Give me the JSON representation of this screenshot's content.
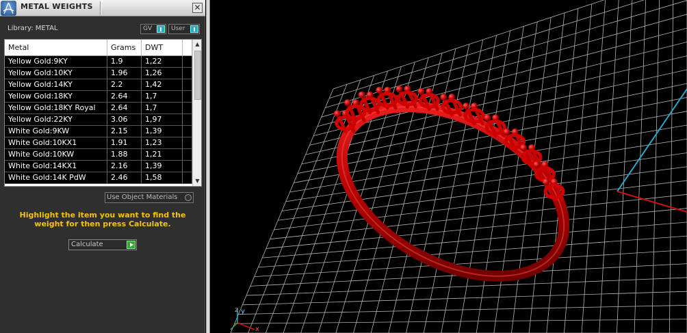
{
  "panel": {
    "title": "METAL WEIGHTS",
    "close_glyph": "✕",
    "library_label": "Library: METAL",
    "gv_label": "GV",
    "user_label": "User",
    "use_object_materials": "Use Object Materials",
    "hint": "Highlight the item you want to find the weight for then press Calculate.",
    "calculate_label": "Calculate"
  },
  "table": {
    "columns": [
      "Metal",
      "Grams",
      "DWT"
    ],
    "rows": [
      {
        "metal": "Yellow Gold:9KY",
        "grams": "1.9",
        "dwt": "1,22"
      },
      {
        "metal": "Yellow Gold:10KY",
        "grams": "1.96",
        "dwt": "1,26"
      },
      {
        "metal": "Yellow Gold:14KY",
        "grams": "2.2",
        "dwt": "1,42"
      },
      {
        "metal": "Yellow Gold:18KY",
        "grams": "2.64",
        "dwt": "1,7"
      },
      {
        "metal": "Yellow Gold:18KY Royal",
        "grams": "2.64",
        "dwt": "1,7"
      },
      {
        "metal": "Yellow Gold:22KY",
        "grams": "3.06",
        "dwt": "1,97"
      },
      {
        "metal": "White Gold:9KW",
        "grams": "2.15",
        "dwt": "1,39"
      },
      {
        "metal": "White Gold:10KX1",
        "grams": "1.91",
        "dwt": "1,23"
      },
      {
        "metal": "White Gold:10KW",
        "grams": "1.88",
        "dwt": "1,21"
      },
      {
        "metal": "White Gold:14KX1",
        "grams": "2.16",
        "dwt": "1,39"
      },
      {
        "metal": "White Gold:14K PdW",
        "grams": "2.46",
        "dwt": "1,58"
      }
    ]
  },
  "viewport": {
    "axis_y": "y",
    "axis_z": "z",
    "axis_x": "x"
  },
  "colors": {
    "panel_bg": "#2f2f2f",
    "hint": "#f5c400",
    "ring": "#cc0000",
    "grid": "#bbbbbb",
    "axis_x": "#d01010",
    "axis_y": "#2aa9c9"
  },
  "icons": [
    "app-logo-icon",
    "close-icon",
    "toggle-knob-icon",
    "radio-icon",
    "play-arrow-icon",
    "scroll-up-icon",
    "scroll-down-icon",
    "axis-triad-icon"
  ]
}
